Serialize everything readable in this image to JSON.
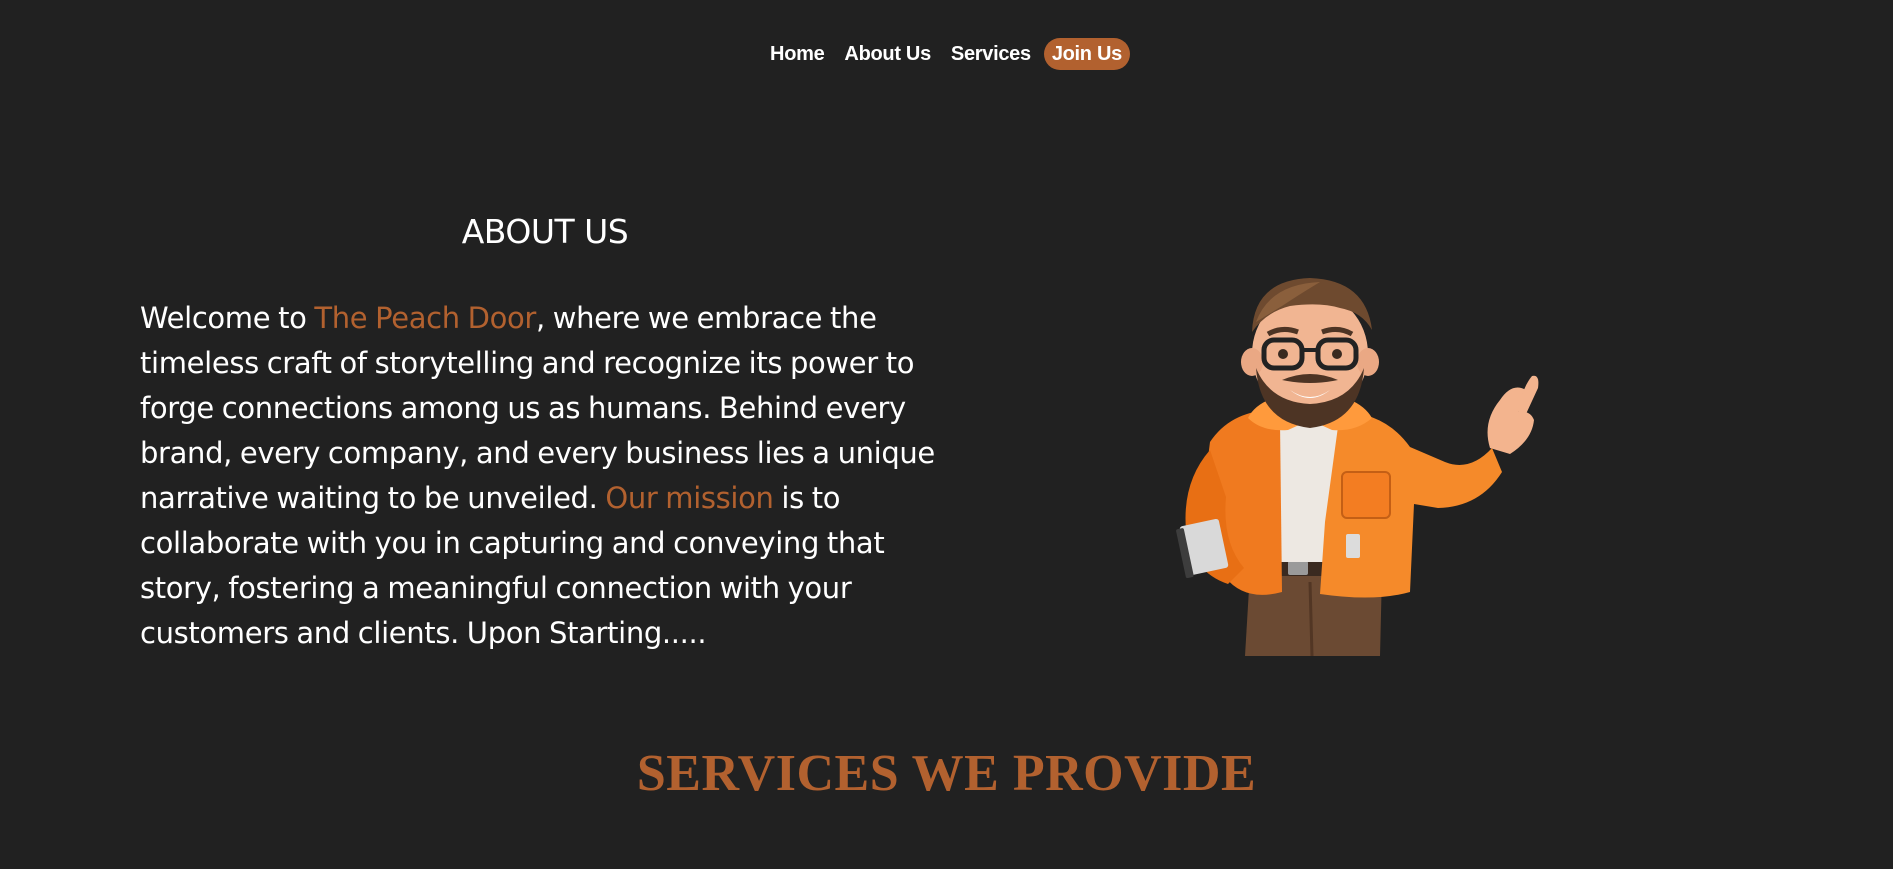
{
  "nav": {
    "items": [
      {
        "label": "Home",
        "active": false
      },
      {
        "label": "About Us",
        "active": false
      },
      {
        "label": "Services",
        "active": false
      },
      {
        "label": "Join Us",
        "active": true
      }
    ]
  },
  "about": {
    "title": "ABOUT US",
    "text_part1": "Welcome to ",
    "brand_name": "The Peach Door",
    "text_part2": ", where we embrace the timeless craft of storytelling and recognize its power to forge connections among us as humans. Behind every brand, every company, and every business lies a unique narrative waiting to be unveiled. ",
    "mission_label": "Our mission",
    "text_part3": " is to collaborate with you in capturing and conveying that story, fostering a meaningful connection with your customers and clients. Upon Starting....."
  },
  "services": {
    "title": "SERVICES WE PROVIDE"
  },
  "colors": {
    "background": "#212121",
    "accent": "#b2612f",
    "text": "#ffffff"
  }
}
